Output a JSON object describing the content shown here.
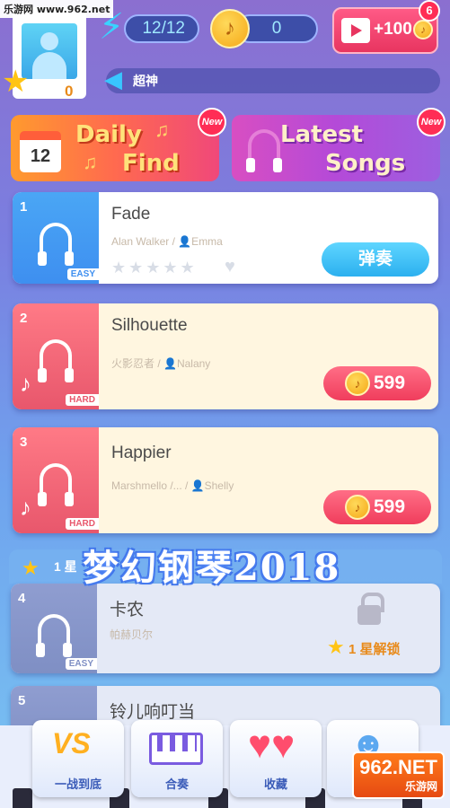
{
  "watermark_top": "乐游网 www.962.net",
  "player": {
    "level": "0"
  },
  "energy": {
    "value": "12/12"
  },
  "coins": {
    "value": "0"
  },
  "video_reward": {
    "label": "+100",
    "badge_count": "6"
  },
  "rank_bar": {
    "text": "超神"
  },
  "features": {
    "daily": {
      "line1": "Daily",
      "line2": "Find",
      "calendar_day": "12",
      "badge": "New"
    },
    "latest": {
      "line1": "Latest",
      "line2": "Songs",
      "badge": "New"
    }
  },
  "songs": [
    {
      "number": "1",
      "title": "Fade",
      "artist": "Alan Walker / 👤Emma",
      "difficulty": "EASY",
      "action": "弹奏"
    },
    {
      "number": "2",
      "title": "Silhouette",
      "artist": "火影忍者 / 👤Nalany",
      "difficulty": "HARD",
      "price": "599"
    },
    {
      "number": "3",
      "title": "Happier",
      "artist": "Marshmello /... / 👤Shelly",
      "difficulty": "HARD",
      "price": "599"
    },
    {
      "number": "4",
      "title": "卡农",
      "artist": "帕赫贝尔",
      "difficulty": "EASY",
      "unlock_text": "1 星解锁"
    },
    {
      "number": "5",
      "title": "铃儿响叮当"
    }
  ],
  "section": {
    "label": "1 星"
  },
  "app_logo_text": "梦幻钢琴2018",
  "nav": [
    {
      "label": "一战到底"
    },
    {
      "label": "合奏"
    },
    {
      "label": "收藏"
    },
    {
      "label": ""
    }
  ],
  "watermark_br": {
    "main": "962.NET",
    "sub": "乐游网"
  },
  "colors": {
    "accent_blue": "#2bb0ef",
    "price_red": "#f03d5c",
    "coin_gold": "#f5a817",
    "card_blue": "#3e8ff0",
    "card_hard": "#f2607a",
    "card_locked": "#7f8fc4"
  }
}
